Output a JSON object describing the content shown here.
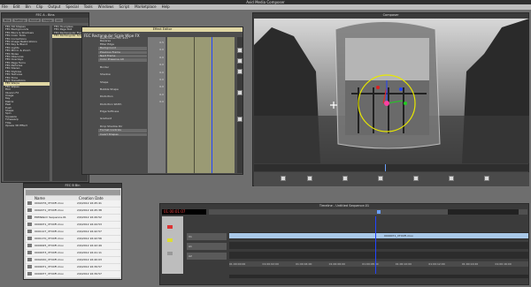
{
  "app_title": "Avid Media Composer",
  "menu": [
    "File",
    "Edit",
    "Bin",
    "Clip",
    "Output",
    "Special",
    "Tools",
    "Windows",
    "Script",
    "Marketplace",
    "Help"
  ],
  "bin_panel": {
    "title": "FEC A - Bins",
    "tabs": [
      "Bins",
      "Settings",
      "Format",
      "Usage",
      "Info"
    ],
    "effect_categories": [
      "FEC 3D Shapes",
      "FEC Backgrounds",
      "FEC Blurs & Shadows",
      "FEC Color Tools",
      "FEC Corrections",
      "FEC Image Restorations",
      "FEC Key & Blend",
      "FEC Lights",
      "FEC Mirror & Zoom",
      "FEC Noise",
      "FEC Obscures",
      "FEC Overlays",
      "FEC Page Turns",
      "FEC Particles",
      "FEC Stereo",
      "FEC Stylizes",
      "FEC Textures",
      "FEC Time",
      "FEC Transitions",
      "FEC Warps",
      "FEC Wipes",
      "Film",
      "Illusion FX",
      "Image",
      "Key",
      "Matrix",
      "Peel",
      "Push",
      "Shape",
      "Spin",
      "Squeeze",
      "Timewarp",
      "Title",
      "Xpress 3D Effect"
    ],
    "selected_category": "FEC Warps",
    "effects": [
      "FEC Hourglass",
      "FEC Page Roll",
      "FEC Rectangular Flex",
      "FEC Rectangular Scal"
    ],
    "selected_effect": "FEC Rectangular Scal"
  },
  "effect_editor": {
    "title": "Effect Editor",
    "effect_name": "FEC Rectangular Scale Wipe FX",
    "options": [
      "Reproduces FEC #10",
      "Reverse",
      "Filter Edge"
    ],
    "groups": [
      "Background",
      "Previous Frame",
      "Next Frame",
      "Color Preserve Alt"
    ],
    "controls": [
      {
        "label": "Border",
        "value": "0.5"
      },
      {
        "label": "Shadow",
        "value": "0.0"
      },
      {
        "label": "Shape",
        "value": "0.0"
      },
      {
        "label": "Bubble Shape",
        "value": "0.0"
      },
      {
        "label": "Distortion",
        "value": "0.0"
      },
      {
        "label": "Distortion Width",
        "value": "0.0"
      },
      {
        "label": "Edge Softness",
        "value": "0.0"
      },
      {
        "label": "Gradient",
        "value": "0.0"
      },
      {
        "label": "Drop Shadow Dir",
        "value": "0.0"
      }
    ],
    "extra_groups": [
      "Format Controls",
      "Invert Shapes"
    ]
  },
  "composer": {
    "title": "Composer"
  },
  "fec_bin": {
    "title": "FEC B Bin",
    "columns": [
      "Name",
      "Creation Date"
    ],
    "rows": [
      {
        "name": "0002276_VTX4Fl.mov",
        "date": "2/9/2012 16:45:41"
      },
      {
        "name": "0002271_VTX4Fl.mov",
        "date": "2/9/2012 16:45:38"
      },
      {
        "name": "ERMWarm Sequence.01",
        "date": "2/9/2012 16:49:52"
      },
      {
        "name": "0000071_VTX4Fl.mov",
        "date": "2/9/2012 16:44:53"
      },
      {
        "name": "0001127_VTX4Fl.mov",
        "date": "2/9/2012 16:42:57"
      },
      {
        "name": "0001170_VTX4Fl.mov",
        "date": "2/9/2012 16:42:56"
      },
      {
        "name": "0000025_VTX4Fl.mov",
        "date": "2/9/2012 16:42:49"
      },
      {
        "name": "0000073_VTX4Fl.mov",
        "date": "2/9/2012 16:41:11"
      },
      {
        "name": "0002220_VTX4Fl.mov",
        "date": "2/9/2012 16:40:03"
      },
      {
        "name": "0000071_VTX4Fl.mov",
        "date": "2/9/2012 16:39:57"
      },
      {
        "name": "0000077_VTX4Fl.mov",
        "date": "2/9/2012 16:39:57"
      }
    ]
  },
  "timeline": {
    "title": "Timeline - Untitled Sequence.01",
    "timecode": "01:00:01:07",
    "tracks": [
      "V1",
      "A1",
      "A2"
    ],
    "clip_label": "0000071_VTX4Fl.mov",
    "ruler": [
      "01:00:00:00",
      "01:00:02:00",
      "01:00:04:00",
      "01:00:06:00",
      "01:00:08:00",
      "01:00:10:00",
      "01:00:12:00",
      "01:00:14:00",
      "01:00:16:00"
    ]
  },
  "colors": {
    "selection": "#e0d7a4",
    "lane": "#86866a",
    "clip": "#a9c8e8",
    "effect_title": "#e0d7a4"
  }
}
